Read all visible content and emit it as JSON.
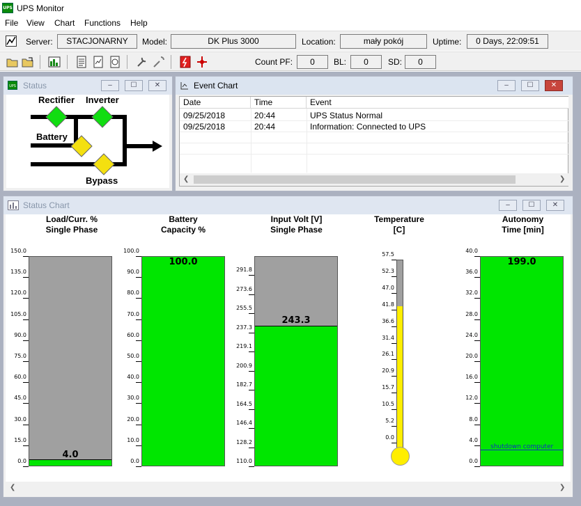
{
  "app": {
    "title": "UPS Monitor",
    "icon_text": "UPS"
  },
  "menu": [
    "File",
    "View",
    "Chart",
    "Functions",
    "Help"
  ],
  "info": {
    "server_label": "Server:",
    "server": "STACJONARNY",
    "model_label": "Model:",
    "model": "DK Plus 3000",
    "location_label": "Location:",
    "location": "mały pokój",
    "uptime_label": "Uptime:",
    "uptime": "0 Days, 22:09:51"
  },
  "counters": {
    "pf_label": "Count PF:",
    "pf": "0",
    "bl_label": "BL:",
    "bl": "0",
    "sd_label": "SD:",
    "sd": "0"
  },
  "toolbar_icons": [
    "open-folder-icon",
    "save-icon",
    "chart-icon",
    "report-1-icon",
    "report-2-icon",
    "report-3-icon",
    "wrench-icon",
    "tools-icon",
    "battery-test-icon",
    "disconnect-icon"
  ],
  "status_window": {
    "title": "Status",
    "rectifier": "Rectifier",
    "inverter": "Inverter",
    "battery": "Battery",
    "bypass": "Bypass"
  },
  "event_window": {
    "title": "Event Chart",
    "columns": [
      "Date",
      "Time",
      "Event"
    ],
    "rows": [
      [
        "09/25/2018",
        "20:44",
        "UPS Status Normal"
      ],
      [
        "09/25/2018",
        "20:44",
        "Information: Connected to UPS"
      ]
    ]
  },
  "status_chart": {
    "title": "Status Chart",
    "gauges": [
      {
        "title1": "Load/Curr. %",
        "title2": "Single Phase",
        "value": "4.0",
        "value_num": 4.0,
        "ticks": [
          "150.0",
          "135.0",
          "120.0",
          "105.0",
          "90.0",
          "75.0",
          "60.0",
          "45.0",
          "30.0",
          "15.0",
          "0.0"
        ],
        "min": 0,
        "max": 150
      },
      {
        "title1": "Battery",
        "title2": "Capacity %",
        "value": "100.0",
        "value_num": 100.0,
        "ticks": [
          "100.0",
          "90.0",
          "80.0",
          "70.0",
          "60.0",
          "50.0",
          "40.0",
          "30.0",
          "20.0",
          "10.0",
          "0.0"
        ],
        "min": 0,
        "max": 100
      },
      {
        "title1": "Input Volt [V]",
        "title2": "Single Phase",
        "value": "243.3",
        "value_num": 243.3,
        "ticks": [
          "291.8",
          "273.6",
          "255.5",
          "237.3",
          "219.1",
          "200.9",
          "182.7",
          "164.5",
          "146.4",
          "128.2",
          "110.0"
        ],
        "min": 110,
        "max": 310
      },
      {
        "title1": "Autonomy",
        "title2": "Time [min]",
        "value": "199.0",
        "value_num": 199.0,
        "ticks": [
          "40.0",
          "36.0",
          "32.0",
          "28.0",
          "24.0",
          "20.0",
          "16.0",
          "12.0",
          "8.0",
          "4.0",
          "0.0"
        ],
        "min": 0,
        "max": 40,
        "marker_label": "shutdown computer",
        "marker_value": 3.0
      }
    ],
    "temperature": {
      "title1": "Temperature",
      "title2": "[C]",
      "ticks": [
        "57.5",
        "52.3",
        "47.0",
        "41.8",
        "36.6",
        "31.4",
        "26.1",
        "20.9",
        "15.7",
        "10.5",
        "5.2",
        "0.0"
      ],
      "min": 0,
      "max": 57.5,
      "value_num": 42.7
    }
  },
  "colors": {
    "fill": "#00e600",
    "empty": "#a0a0a0",
    "thermo": "#ffee00",
    "mdi": "#abb1c0"
  }
}
